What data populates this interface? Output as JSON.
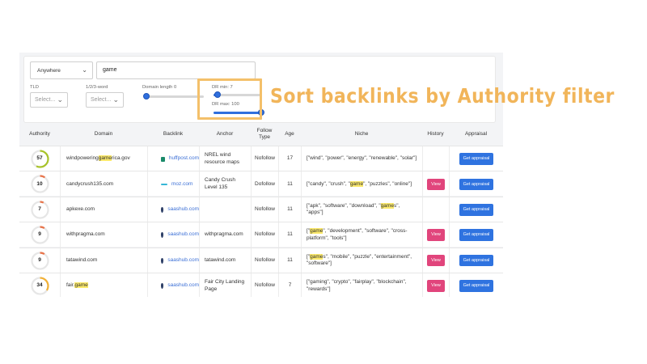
{
  "filters": {
    "location_select": "Anywhere",
    "search_value": "game",
    "tld_label": "TLD",
    "tld_placeholder": "Select...",
    "word_label": "1/2/3-word",
    "word_placeholder": "Select...",
    "domain_length_label": "Domain length 0",
    "domain_length_value": 0,
    "dr_min_label": "DR min: 7",
    "dr_min_value": 7,
    "dr_max_label": "DR max: 100",
    "dr_max_value": 100
  },
  "overlay": {
    "caption": "Sort backlinks by Authority filter",
    "color": "#f1b55a"
  },
  "table": {
    "headers": {
      "authority": "Authority",
      "domain": "Domain",
      "backlink": "Backlink",
      "anchor": "Anchor",
      "follow_type": "Follow Type",
      "age": "Age",
      "niche": "Niche",
      "history": "History",
      "appraisal": "Appraisal"
    },
    "view_label": "View",
    "appraisal_label": "Get appraisal",
    "rows": [
      {
        "authority": "57",
        "gauge_color": "#a8c32a",
        "gauge_fraction": 0.57,
        "domain_pre": "windpowering",
        "domain_hl": "game",
        "domain_post": "rica.gov",
        "backlink_icon": "huffpost-favicon",
        "backlink_icon_color": "#1a8a6a",
        "backlink": "huffpost.com",
        "anchor": "NREL wind resource maps",
        "follow": "Nofollow",
        "age": "17",
        "niche_pre": "[\"wind\", \"power\", \"energy\", \"renewable\", \"solar\"]",
        "niche_hl": "",
        "niche_post": "",
        "has_view": false
      },
      {
        "authority": "10",
        "gauge_color": "#e8744a",
        "gauge_fraction": 0.1,
        "domain_pre": "candycrush135.com",
        "domain_hl": "",
        "domain_post": "",
        "backlink_icon": "moz-favicon",
        "backlink_icon_color": "#35b6d6",
        "backlink": "moz.com",
        "anchor": "Candy Crush Level 135",
        "follow": "Dofollow",
        "age": "11",
        "niche_pre": "[\"candy\", \"crush\", \"",
        "niche_hl": "game",
        "niche_post": "\", \"puzzles\", \"online\"]",
        "has_view": true
      },
      {
        "authority": "7",
        "gauge_color": "#e8744a",
        "gauge_fraction": 0.07,
        "domain_pre": "apkexe.com",
        "domain_hl": "",
        "domain_post": "",
        "backlink_icon": "saashub-favicon",
        "backlink_icon_color": "#2c3e66",
        "backlink": "saashub.com",
        "anchor": "",
        "follow": "Nofollow",
        "age": "11",
        "niche_pre": "[\"apk\", \"software\", \"download\", \"",
        "niche_hl": "game",
        "niche_post": "s\", \"apps\"]",
        "has_view": false
      },
      {
        "authority": "9",
        "gauge_color": "#e8744a",
        "gauge_fraction": 0.09,
        "domain_pre": "withpragma.com",
        "domain_hl": "",
        "domain_post": "",
        "backlink_icon": "saashub-favicon",
        "backlink_icon_color": "#2c3e66",
        "backlink": "saashub.com",
        "anchor": "withpragma.com",
        "follow": "Nofollow",
        "age": "11",
        "niche_pre": "[\"",
        "niche_hl": "game",
        "niche_post": "\", \"development\", \"software\", \"cross-platform\", \"tools\"]",
        "has_view": true
      },
      {
        "authority": "9",
        "gauge_color": "#e8744a",
        "gauge_fraction": 0.09,
        "domain_pre": "tatawind.com",
        "domain_hl": "",
        "domain_post": "",
        "backlink_icon": "saashub-favicon",
        "backlink_icon_color": "#2c3e66",
        "backlink": "saashub.com",
        "anchor": "tatawind.com",
        "follow": "Nofollow",
        "age": "11",
        "niche_pre": "[\"",
        "niche_hl": "game",
        "niche_post": "s\", \"mobile\", \"puzzle\", \"entertainment\", \"software\"]",
        "has_view": true
      },
      {
        "authority": "34",
        "gauge_color": "#f2b137",
        "gauge_fraction": 0.34,
        "domain_pre": "fair.",
        "domain_hl": "game",
        "domain_post": "",
        "backlink_icon": "saashub-favicon",
        "backlink_icon_color": "#2c3e66",
        "backlink": "saashub.com",
        "anchor": "Fair City Landing Page",
        "follow": "Nofollow",
        "age": "7",
        "niche_pre": "[\"gaming\", \"crypto\", \"fairplay\", \"blockchain\", \"rewards\"]",
        "niche_hl": "",
        "niche_post": "",
        "has_view": true
      }
    ]
  }
}
